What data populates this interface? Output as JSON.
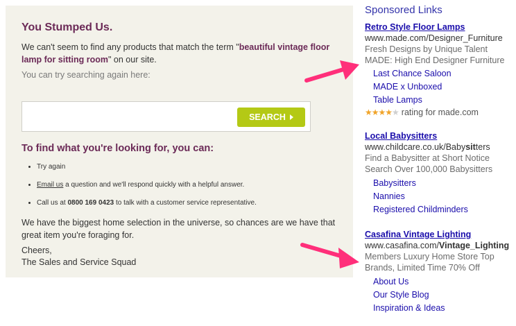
{
  "main": {
    "title": "You Stumped Us.",
    "message_prefix": "We can't seem to find any products that match the term \"",
    "message_term": "beautiful vintage floor lamp for sitting room",
    "message_suffix": "\" on our site.",
    "retry_text": "You can try searching again here:",
    "search": {
      "value": "",
      "placeholder": "",
      "button_label": "SEARCH"
    },
    "subtitle": "To find what you're looking for, you can:",
    "tips": {
      "try_again": "Try again",
      "email_link": "Email us",
      "email_rest": " a question and we'll respond quickly with a helpful answer.",
      "call_prefix": "Call us at ",
      "call_number": "0800 169 0423",
      "call_suffix": " to talk with a customer service representative."
    },
    "stock_text": "We have the biggest home selection in the universe, so chances are we have that great item you're foraging for.",
    "signoff_1": "Cheers,",
    "signoff_2": "The Sales and Service Squad"
  },
  "sidebar": {
    "title": "Sponsored Links",
    "ads": [
      {
        "title": "Retro Style Floor Lamps",
        "url_prefix": "www.made.com/",
        "url_bold": "Designer_Furniture",
        "desc_1": "Fresh Designs by Unique Talent",
        "desc_2": "MADE: High End Designer Furniture",
        "links": [
          "Last Chance Saloon",
          "MADE x Unboxed",
          "Table Lamps"
        ],
        "rating": 4,
        "rating_text": "rating for made.com"
      },
      {
        "title": "Local Babysitters",
        "url_prefix": "www.childcare.co.uk/Baby",
        "url_bold": "sit",
        "url_suffix": "ters",
        "desc_1": "Find a Babysitter at Short Notice",
        "desc_2": "Search Over 100,000 Babysitters",
        "links": [
          "Babysitters",
          "Nannies",
          "Registered Childminders"
        ]
      },
      {
        "title": "Casafina Vintage Lighting",
        "url_prefix": "www.casafina.com/",
        "url_bold": "Vintage_Lighting",
        "desc_1": "Members Luxury Home Store Top Brands, Limited Time 70% Off",
        "links": [
          "About Us",
          "Our Style Blog",
          "Inspiration & Ideas"
        ]
      }
    ]
  },
  "colors": {
    "heading": "#6b2a57",
    "ad_link": "#1a0dab",
    "search_button": "#b4c915",
    "annotation_arrow": "#ff2f7a",
    "panel_bg": "#f3f2ea"
  }
}
